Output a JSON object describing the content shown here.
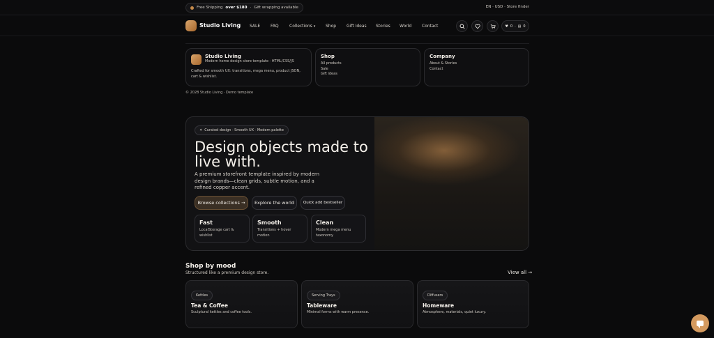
{
  "topbar": {
    "promo_prefix": "Free Shipping",
    "promo_bold": "over $180",
    "promo_extra": "Gift wrapping available",
    "links": "EN · USD · Store finder"
  },
  "nav": {
    "brand": "Studio Living",
    "links": [
      "SALE",
      "FAQ",
      "Collections",
      "Shop",
      "Gift Ideas",
      "Stories",
      "World",
      "Contact"
    ],
    "collections_caret": "▾",
    "wishlist_count": "0",
    "cart_count": "0"
  },
  "footer": {
    "brand_card": {
      "title": "Studio Living",
      "subtitle": "Modern home design store template · HTML/CSS/JS",
      "desc": "Crafted for smooth UX: transitions, mega menu, product JSON, cart & wishlist."
    },
    "shop_card": {
      "title": "Shop",
      "items": [
        "All products",
        "Sale",
        "Gift ideas"
      ]
    },
    "company_card": {
      "title": "Company",
      "items": [
        "About & Stories",
        "Contact"
      ]
    },
    "copyright": "© 2028 Studio Living · Demo template"
  },
  "hero": {
    "chip": "Curated design · Smooth UX · Modern palette",
    "title": "Design objects made to live with.",
    "subtitle": "A premium storefront template inspired by modern design brands—clean grids, subtle motion, and a refined copper accent.",
    "buttons": [
      "Browse collections →",
      "Explore the world",
      "Quick add bestseller"
    ],
    "stats": [
      {
        "title": "Fast",
        "desc": "LocalStorage cart & wishlist"
      },
      {
        "title": "Smooth",
        "desc": "Transitions + hover motion"
      },
      {
        "title": "Clean",
        "desc": "Modern mega menu taxonomy"
      }
    ]
  },
  "moods": {
    "title": "Shop by mood",
    "subtitle": "Structured like a premium design store.",
    "view_all": "View all →",
    "cards": [
      {
        "tag": "Kettles",
        "title": "Tea & Coffee",
        "desc": "Sculptural kettles and coffee tools."
      },
      {
        "tag": "Serving Trays",
        "title": "Tableware",
        "desc": "Minimal forms with warm presence."
      },
      {
        "tag": "Diffusers",
        "title": "Homeware",
        "desc": "Atmosphere, materials, quiet luxury."
      }
    ]
  },
  "colors": {
    "accent": "#d49a5f",
    "background": "#0b0b0c"
  }
}
